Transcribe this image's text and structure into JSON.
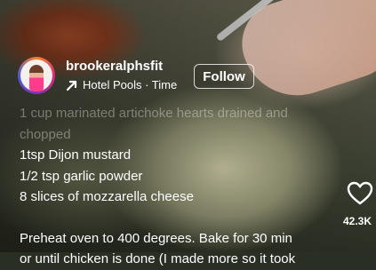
{
  "post": {
    "username": "brookeralphsfit",
    "music": "Hotel Pools · Time",
    "follow_label": "Follow"
  },
  "caption": {
    "lines": [
      "1 cup marinated artichoke hearts drained and",
      "chopped",
      "1tsp Dijon mustard",
      "1/2 tsp garlic powder",
      "8 slices of mozzarella cheese",
      "",
      "Preheat oven to 400 degrees. Bake for 30 min",
      "or until chicken is done (I made more so it took"
    ]
  },
  "actions": {
    "like_count": "42.3K"
  },
  "icons": {
    "music": "arrow-icon",
    "like": "heart-icon"
  }
}
